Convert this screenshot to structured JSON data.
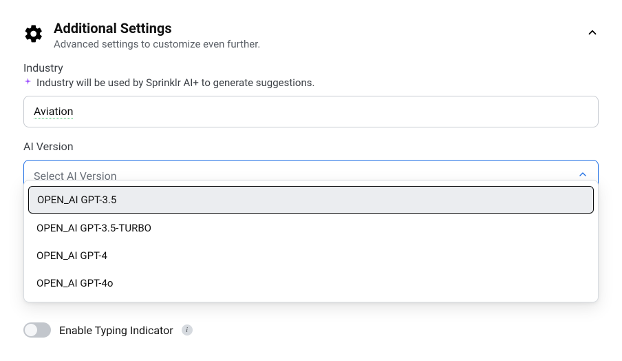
{
  "header": {
    "title": "Additional Settings",
    "subtitle": "Advanced settings to customize even further."
  },
  "industry": {
    "label": "Industry",
    "hint": "Industry will be used by Sprinklr AI+ to generate suggestions.",
    "value": "Aviation"
  },
  "ai_version": {
    "label": "AI Version",
    "placeholder": "Select AI Version",
    "options": [
      "OPEN_AI GPT-3.5",
      "OPEN_AI GPT-3.5-TURBO",
      "OPEN_AI GPT-4",
      "OPEN_AI GPT-4o"
    ]
  },
  "typing_indicator": {
    "label": "Enable Typing Indicator"
  }
}
